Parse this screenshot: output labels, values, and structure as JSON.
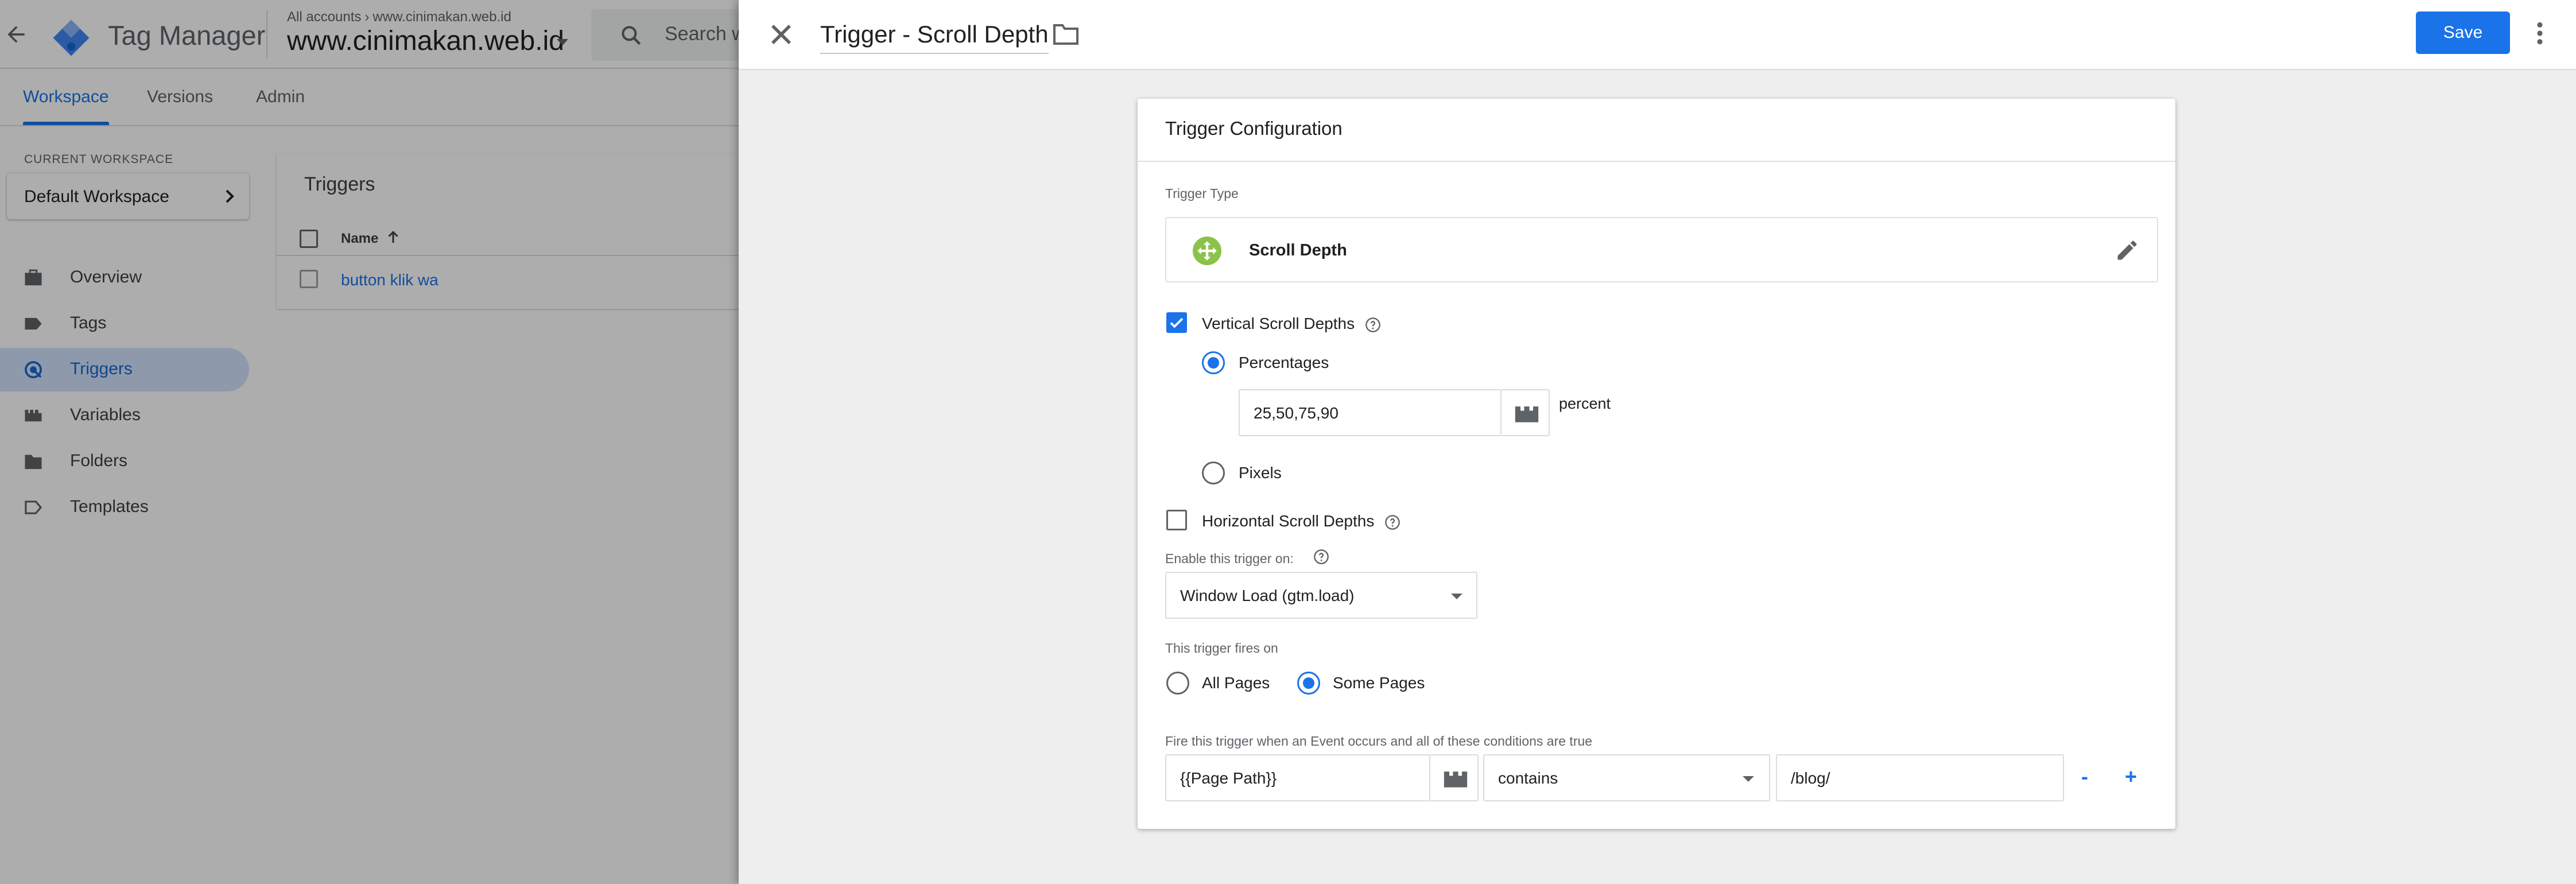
{
  "app": {
    "product_name": "Tag Manager",
    "breadcrumb": [
      "All accounts",
      "www.cinimakan.web.id"
    ],
    "container_name": "www.cinimakan.web.id",
    "search_placeholder": "Search w"
  },
  "tabs": [
    {
      "label": "Workspace",
      "active": true
    },
    {
      "label": "Versions",
      "active": false
    },
    {
      "label": "Admin",
      "active": false
    }
  ],
  "sidebar": {
    "current_workspace_label": "CURRENT WORKSPACE",
    "workspace_name": "Default Workspace",
    "items": [
      {
        "label": "Overview",
        "icon": "briefcase-icon",
        "active": false
      },
      {
        "label": "Tags",
        "icon": "tag-icon",
        "active": false
      },
      {
        "label": "Triggers",
        "icon": "trigger-icon",
        "active": true
      },
      {
        "label": "Variables",
        "icon": "variables-icon",
        "active": false
      },
      {
        "label": "Folders",
        "icon": "folder-icon",
        "active": false
      },
      {
        "label": "Templates",
        "icon": "template-icon",
        "active": false
      }
    ]
  },
  "triggers_list": {
    "title": "Triggers",
    "column_name": "Name",
    "rows": [
      {
        "name": "button klik wa"
      }
    ]
  },
  "editor": {
    "title": "Trigger - Scroll Depth",
    "save_label": "Save",
    "card_title": "Trigger Configuration",
    "trigger_type_label": "Trigger Type",
    "trigger_type": "Scroll Depth",
    "vertical": {
      "label": "Vertical Scroll Depths",
      "checked": true,
      "percentages_label": "Percentages",
      "percentages_value": "25,50,75,90",
      "percent_unit": "percent",
      "pixels_label": "Pixels",
      "selected": "Percentages"
    },
    "horizontal": {
      "label": "Horizontal Scroll Depths",
      "checked": false
    },
    "enable_on": {
      "label": "Enable this trigger on:",
      "value": "Window Load (gtm.load)"
    },
    "fires_on": {
      "label": "This trigger fires on",
      "all_pages": "All Pages",
      "some_pages": "Some Pages",
      "selected": "Some Pages"
    },
    "condition": {
      "label": "Fire this trigger when an Event occurs and all of these conditions are true",
      "variable": "{{Page Path}}",
      "operator": "contains",
      "value": "/blog/",
      "remove_label": "-",
      "add_label": "+"
    }
  },
  "colors": {
    "accent": "#1a73e8",
    "scroll_depth_icon": "#8bc34a",
    "active_nav_bg": "#d2e3fc"
  }
}
